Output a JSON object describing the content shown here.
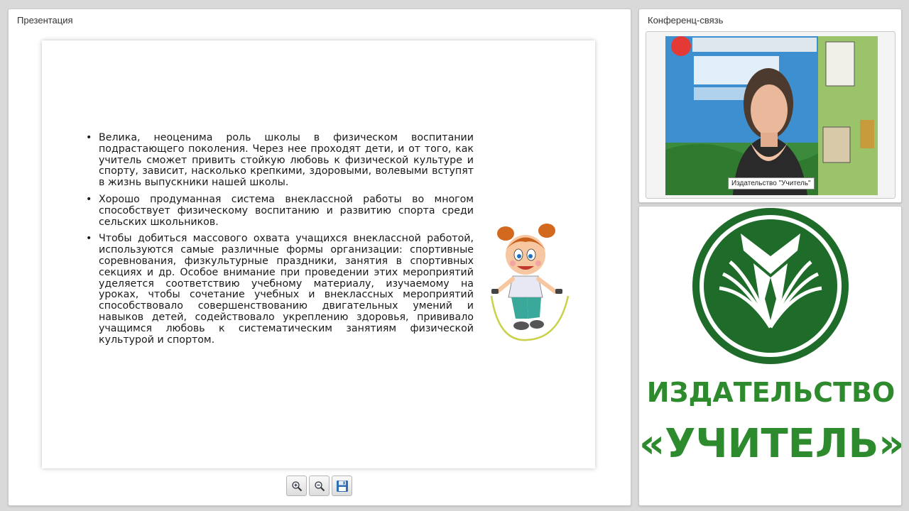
{
  "presentation": {
    "title": "Презентация",
    "bullets": [
      "Велика, неоценима роль школы в физическом воспитании подрастающего поколения. Через нее проходят дети, и от того, как учитель сможет привить стойкую любовь к физической культуре и спорту, зависит, насколько крепкими, здоровыми, волевыми вступят в жизнь выпускники нашей школы.",
      "Хорошо продуманная система внеклассной работы во многом способствует физическому воспитанию и развитию спорта среди сельских школьников.",
      "Чтобы добиться массового охвата учащихся внеклассной работой, используются самые различные формы организации: спортивные соревнования, физкультурные праздники, занятия в спортивных секциях и др. Особое внимание при проведении этих мероприятий уделяется соответствию учебному материалу, изучаемому на уроках, чтобы сочетание учебных и внеклассных мероприятий способствовало совершенствованию двигательных умений и навыков детей, содействовало укреплению здоровья, прививало учащимся любовь к систематическим занятиям физической культурой и спортом."
    ],
    "toolbar": {
      "zoom_in_icon": "zoom-in-icon",
      "zoom_out_icon": "zoom-out-icon",
      "save_icon": "floppy-disk-icon"
    }
  },
  "conference": {
    "title": "Конференц-связь",
    "caller_label": "Издательство \"Учитель\""
  },
  "logo_panel": {
    "line1": "ИЗДАТЕЛЬСТВО",
    "line2": "«УЧИТЕЛЬ»"
  },
  "colors": {
    "brand_green": "#2d8a2d",
    "logo_dark_green": "#1f6b2a",
    "background": "#d9d9d9"
  }
}
